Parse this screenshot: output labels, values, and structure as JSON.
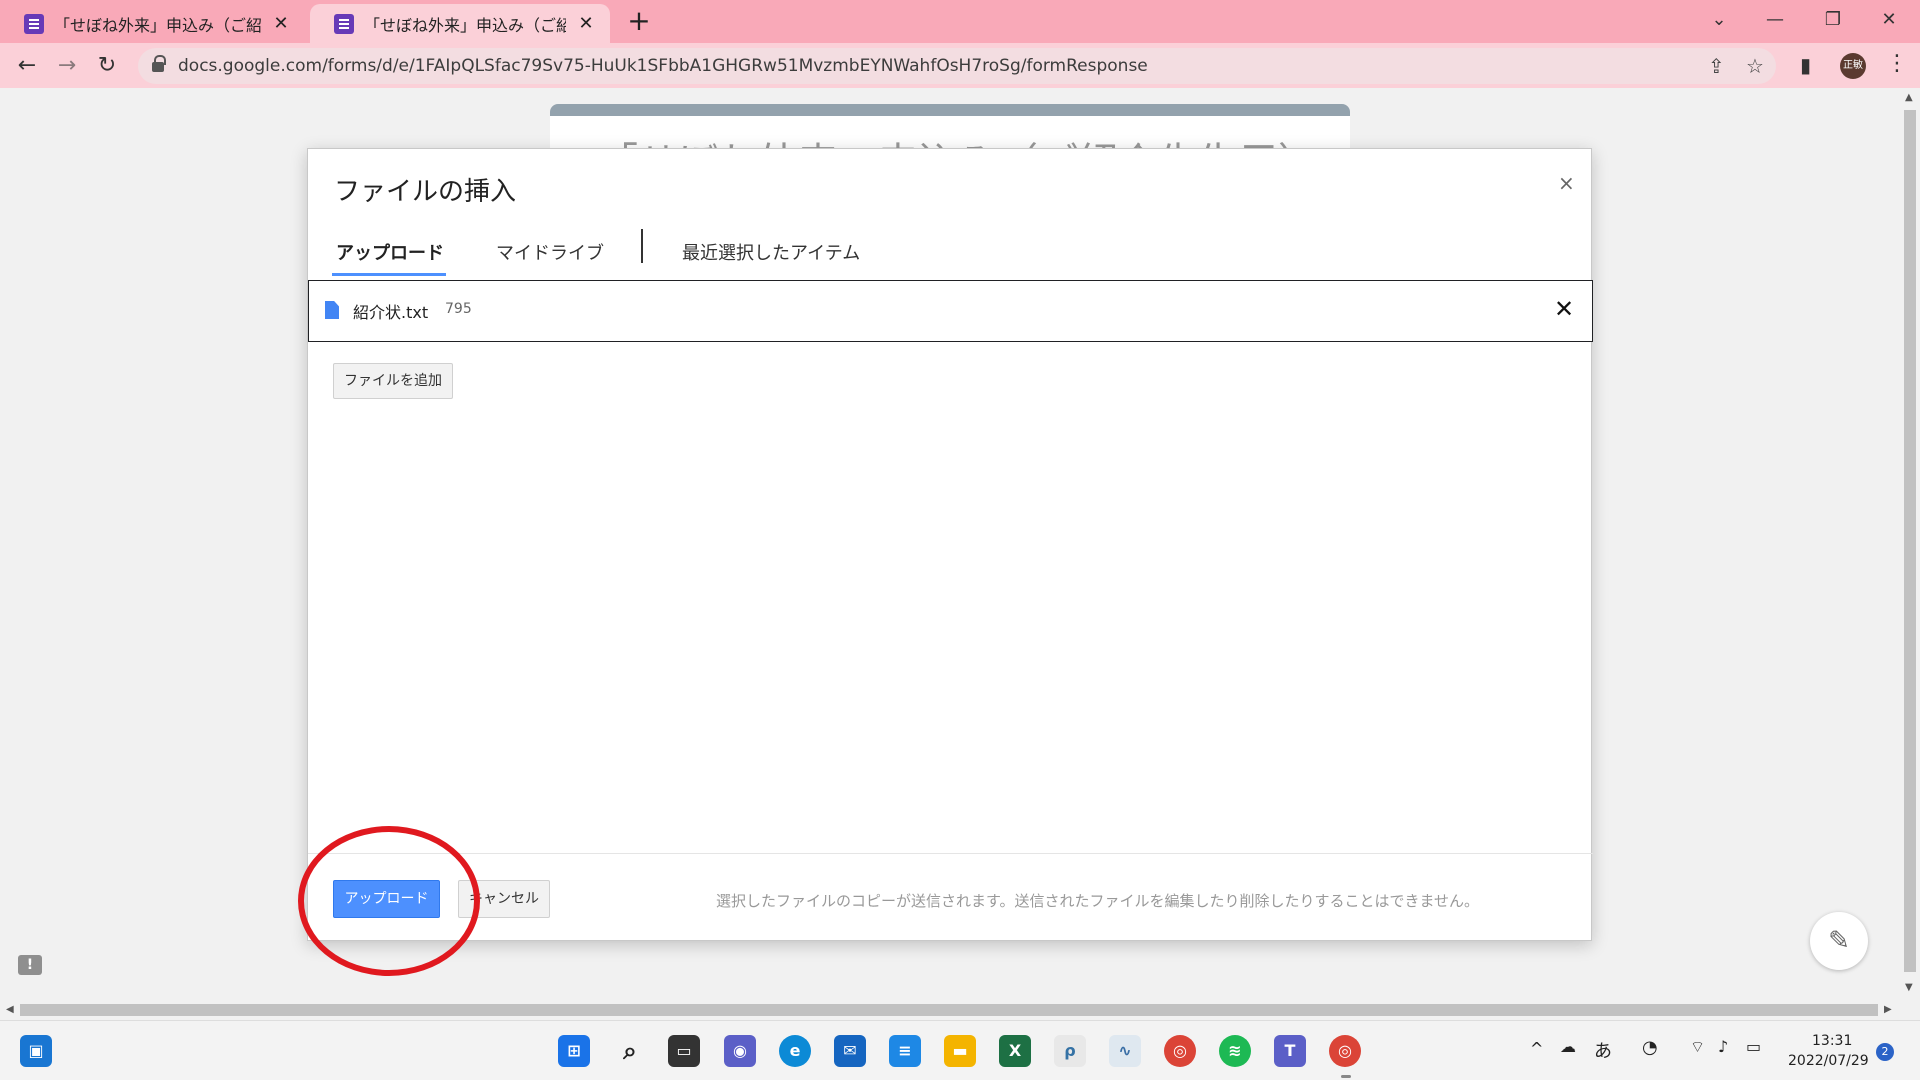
{
  "browser": {
    "tabs": [
      {
        "title": "「せぼね外来」申込み（ご紹介先生用）",
        "active": false
      },
      {
        "title": "「せぼね外来」申込み（ご紹介先生用）",
        "active": true
      }
    ],
    "new_tab_icon": "+",
    "window_controls": {
      "tab_search": "⌄",
      "minimize": "—",
      "restore": "❐",
      "close": "✕"
    },
    "url": "docs.google.com/forms/d/e/1FAIpQLSfac79Sv75-HuUk1SFbbA1GHGRw51MvzmbEYNWahfOsH7roSg/formResponse",
    "profile_initials": "正敏"
  },
  "page": {
    "form_title_partial": "「せぼね外来」申込み（ご紹介先生用）"
  },
  "dialog": {
    "title": "ファイルの挿入",
    "close_glyph": "×",
    "tabs": [
      "アップロード",
      "マイドライブ",
      "最近選択したアイテム"
    ],
    "selected_tab": "アップロード",
    "file": {
      "name": "紹介状.txt",
      "size": "795"
    },
    "remove_glyph": "✕",
    "add_file_label": "ファイルを追加",
    "upload_label": "アップロード",
    "cancel_label": "キャンセル",
    "footer_note": "選択したファイルのコピーが送信されます。送信されたファイルを編集したり削除したりすることはできません。"
  },
  "taskbar": {
    "ime": "あ",
    "time": "13:31",
    "date": "2022/07/29",
    "notification_count": "2",
    "colors": {
      "accent": "#4d90fe",
      "annotation": "#e0191f",
      "tab_bar": "#f9a9b8"
    }
  }
}
